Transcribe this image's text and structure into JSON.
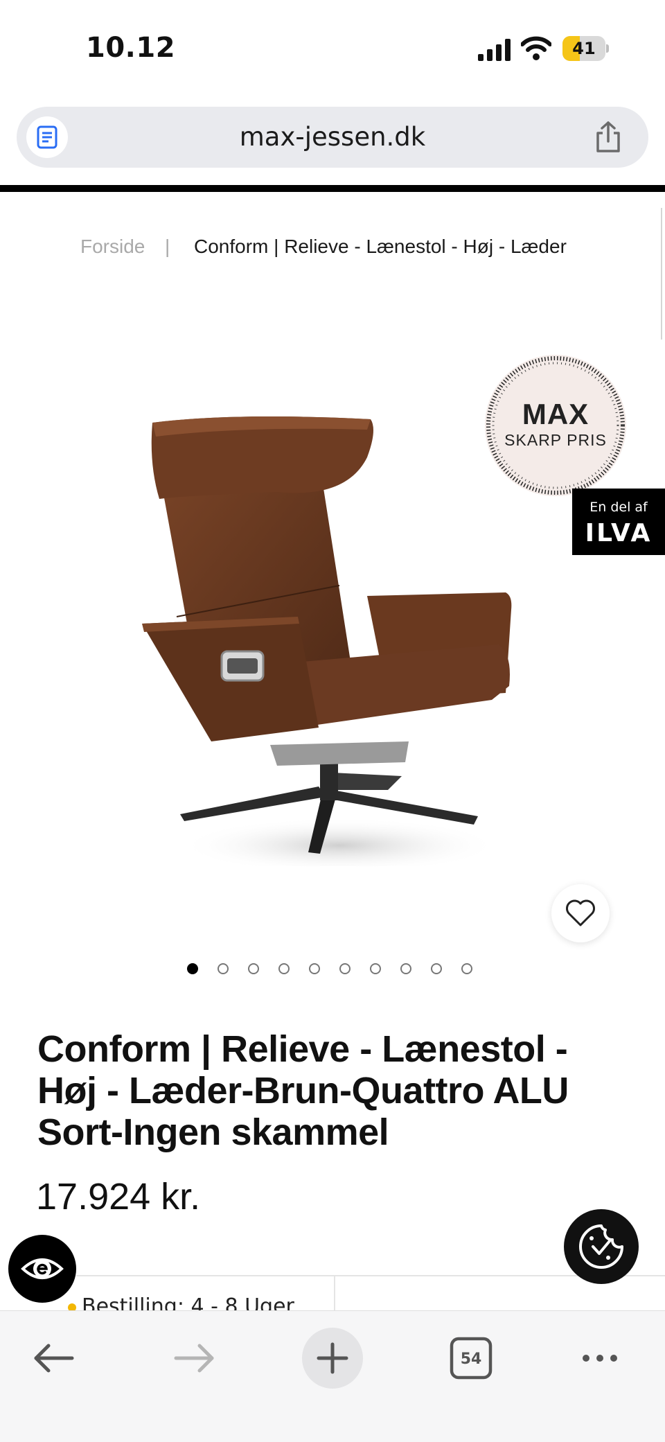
{
  "status_bar": {
    "time": "10.12",
    "battery_level": "41",
    "battery_color": "#f5c518"
  },
  "browser": {
    "url": "max-jessen.dk",
    "tab_count": "54"
  },
  "breadcrumb": {
    "home": "Forside",
    "separator": "|",
    "current": "Conform | Relieve - Lænestol - Høj - Læder"
  },
  "badges": {
    "max_line1": "MAX",
    "max_line2": "SKARP PRIS",
    "ilva_small": "En del af",
    "ilva_logo": "ILVA"
  },
  "gallery": {
    "image_count": 10,
    "active_index": 0
  },
  "product": {
    "title": "Conform | Relieve - Lænestol - Høj - Læder-Brun-Quattro ALU Sort-Ingen skammel",
    "price": "17.924 kr.",
    "delivery": "Bestilling: 4 - 8 Uger"
  },
  "colors": {
    "chair_leather": "#6b3a22",
    "accent_dot": "#f2b705"
  }
}
